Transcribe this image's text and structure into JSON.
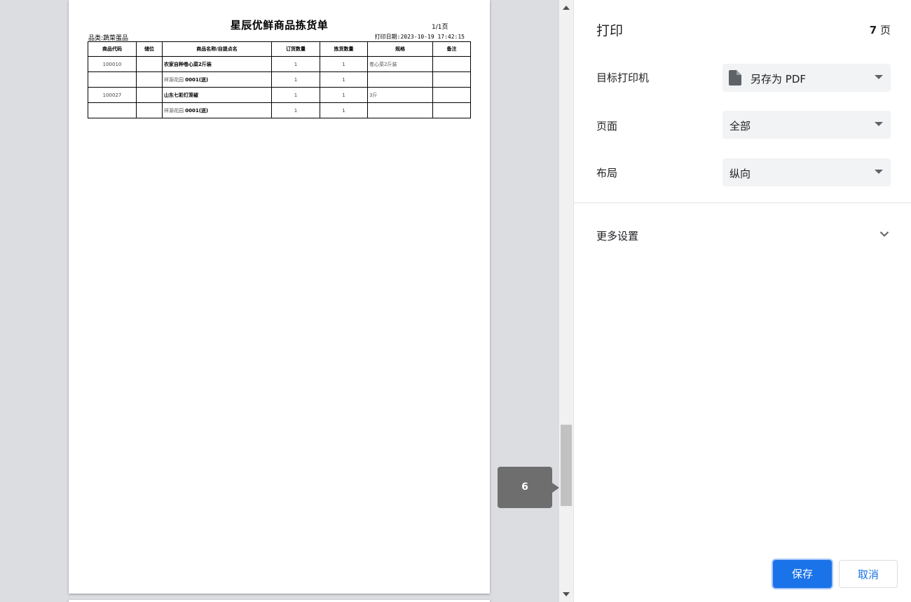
{
  "preview": {
    "document": {
      "title": "星辰优鲜商品拣货单",
      "page_count": "1/1页",
      "category": "品类:蔬菜蛋品",
      "print_date": "打印日期:2023-10-19 17:42:15",
      "headers": [
        "商品代码",
        "储位",
        "商品名称/自提点名",
        "订货数量",
        "拣货数量",
        "规格",
        "备注"
      ],
      "rows": [
        {
          "code": "100010",
          "location": "",
          "name": "农家自种卷心菜2斤装",
          "order_qty": "1",
          "pick_qty": "1",
          "spec": "卷心菜2斤装",
          "note": ""
        },
        {
          "code": "",
          "location": "",
          "pickup_name": "祥源花园",
          "pickup_code": "0001(送)",
          "order_qty": "1",
          "pick_qty": "1",
          "spec": "",
          "note": ""
        },
        {
          "code": "100027",
          "location": "",
          "name": "山东七彩灯笼椒",
          "order_qty": "1",
          "pick_qty": "1",
          "spec": "3斤",
          "note": ""
        },
        {
          "code": "",
          "location": "",
          "pickup_name": "祥源花园",
          "pickup_code": "0001(送)",
          "order_qty": "1",
          "pick_qty": "1",
          "spec": "",
          "note": ""
        }
      ]
    },
    "page_tooltip": "6"
  },
  "panel": {
    "title": "打印",
    "sheet_count_number": "7",
    "sheet_count_unit": "页",
    "destination_label": "目标打印机",
    "destination_value": "另存为 PDF",
    "pages_label": "页面",
    "pages_value": "全部",
    "layout_label": "布局",
    "layout_value": "纵向",
    "more_settings_label": "更多设置",
    "save_label": "保存",
    "cancel_label": "取消"
  },
  "colors": {
    "accent": "#1a73e8",
    "preview_bg": "#dcdde1",
    "select_bg": "#f1f3f4"
  }
}
